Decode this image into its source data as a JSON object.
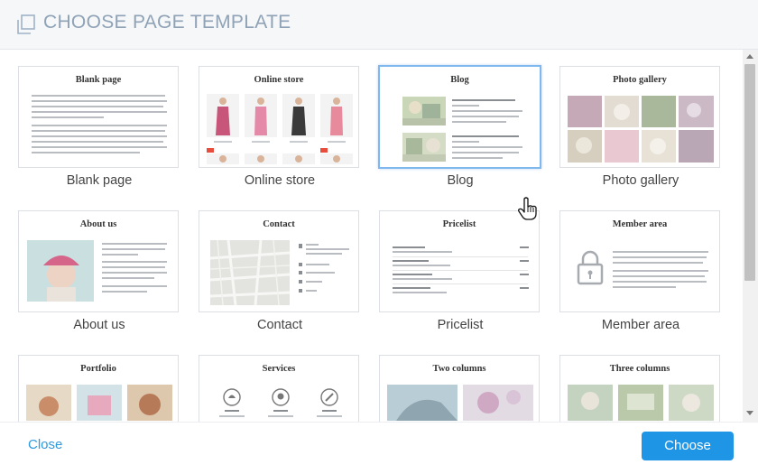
{
  "header": {
    "title": "CHOOSE PAGE TEMPLATE",
    "icon": "copy-pages-icon"
  },
  "templates": [
    {
      "id": "blank-page",
      "thumb_title": "Blank page",
      "label": "Blank page"
    },
    {
      "id": "online-store",
      "thumb_title": "Online store",
      "label": "Online store"
    },
    {
      "id": "blog",
      "thumb_title": "Blog",
      "label": "Blog",
      "selected": true
    },
    {
      "id": "photo-gallery",
      "thumb_title": "Photo gallery",
      "label": "Photo gallery"
    },
    {
      "id": "about-us",
      "thumb_title": "About us",
      "label": "About us"
    },
    {
      "id": "contact",
      "thumb_title": "Contact",
      "label": "Contact"
    },
    {
      "id": "pricelist",
      "thumb_title": "Pricelist",
      "label": "Pricelist"
    },
    {
      "id": "member-area",
      "thumb_title": "Member area",
      "label": "Member area"
    },
    {
      "id": "portfolio",
      "thumb_title": "Portfolio",
      "label": "Portfolio"
    },
    {
      "id": "services",
      "thumb_title": "Services",
      "label": "Services"
    },
    {
      "id": "two-columns",
      "thumb_title": "Two columns",
      "label": "Two columns"
    },
    {
      "id": "three-columns",
      "thumb_title": "Three columns",
      "label": "Three columns"
    }
  ],
  "footer": {
    "close_label": "Close",
    "choose_label": "Choose"
  },
  "colors": {
    "accent": "#1f95e6",
    "link": "#2d9ae0",
    "selected_border": "#7fb8ee",
    "header_text": "#8fa2b6"
  }
}
